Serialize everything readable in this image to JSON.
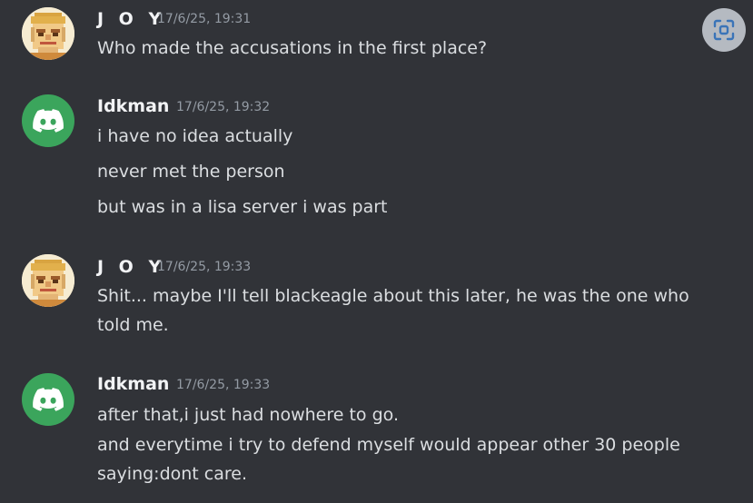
{
  "colors": {
    "background": "#313338",
    "username": "#f2f3f5",
    "message_text": "#dbdee1",
    "timestamp": "#949ba4",
    "discord_avatar_bg": "#3ba55c",
    "scan_button_bg": "#b5bac1",
    "scan_icon": "#3a74b8"
  },
  "scan_button": {
    "icon": "focus-scan-icon"
  },
  "messages": [
    {
      "username": "J O Y",
      "avatar": "pixel-art-face",
      "timestamp": "17/6/25, 19:31",
      "lines": [
        "Who made the accusations in the first place?"
      ]
    },
    {
      "username": "Idkman",
      "avatar": "discord-logo-icon",
      "timestamp": "17/6/25, 19:32",
      "lines": [
        "i have no idea actually",
        "never met the person",
        "but was in a lisa server i was part"
      ]
    },
    {
      "username": "J O Y",
      "avatar": "pixel-art-face",
      "timestamp": "17/6/25, 19:33",
      "lines": [
        "Shit... maybe I'll tell blackeagle about this later, he was the one who",
        "told me."
      ]
    },
    {
      "username": "Idkman",
      "avatar": "discord-logo-icon",
      "timestamp": "17/6/25, 19:33",
      "lines": [
        "after that,i just had nowhere to go.",
        "and everytime i try to defend myself would appear other 30 people",
        "saying:dont care."
      ]
    }
  ]
}
